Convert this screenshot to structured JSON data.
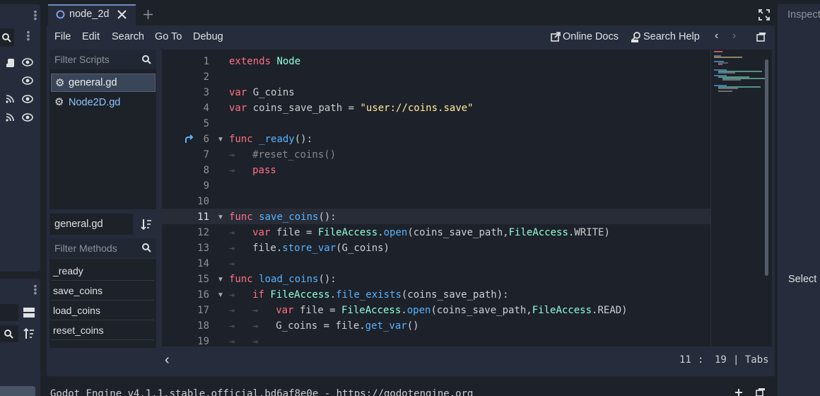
{
  "tabs": [
    {
      "label": "node_2d",
      "active": true
    }
  ],
  "menu": [
    "File",
    "Edit",
    "Search",
    "Go To",
    "Debug"
  ],
  "help_links": {
    "online_docs": "Online Docs",
    "search_help": "Search Help"
  },
  "scripts": {
    "filter_placeholder": "Filter Scripts",
    "items": [
      {
        "label": "general.gd",
        "selected": true
      },
      {
        "label": "Node2D.gd",
        "selected": false
      }
    ]
  },
  "current_script": "general.gd",
  "methods": {
    "filter_placeholder": "Filter Methods",
    "items": [
      "_ready",
      "save_coins",
      "load_coins",
      "reset_coins"
    ]
  },
  "code": {
    "line_numbers": [
      "1",
      "2",
      "3",
      "4",
      "5",
      "6",
      "7",
      "8",
      "9",
      "10",
      "11",
      "12",
      "13",
      "14",
      "15",
      "16",
      "17",
      "18",
      "19"
    ],
    "current_line": 11
  },
  "status": {
    "line": "11",
    "sep": ":",
    "col": "19",
    "indent": "| Tabs"
  },
  "inspector": {
    "title": "Inspect",
    "body": "Select a"
  },
  "output": "Godot Engine v4.1.1.stable.official.bd6af8e0e - https://godotengine.org",
  "colors": {
    "keyword": "#ff7085",
    "type": "#8fffdb",
    "function": "#57b3ff",
    "string": "#ffeda1",
    "comment": "#848b93",
    "accent": "#6f8cbd"
  }
}
